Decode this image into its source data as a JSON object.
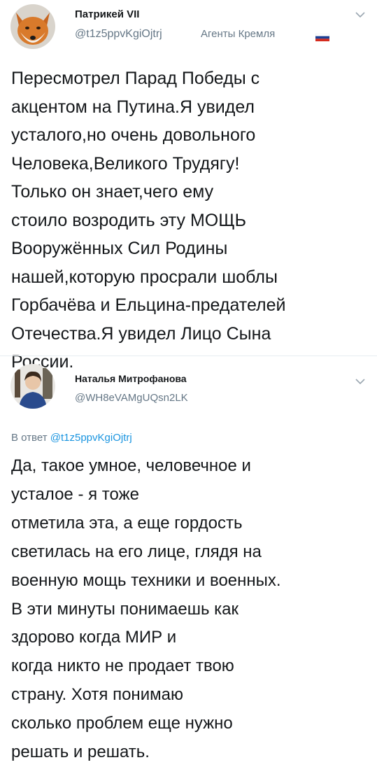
{
  "tweet1": {
    "name": "Патрикей VII",
    "handle": "@t1z5ppvKgiOjtrj",
    "list_name": "Агенты Кремля",
    "body_lines": [
      "Пересмотрел Парад Победы с",
      "акцентом на Путина.Я увидел",
      "усталого,но очень довольного",
      "Человека,Великого Трудягу!",
      "Только он знает,чего ему",
      "стоило возродить эту МОЩЬ",
      "Вооружённых Сил Родины",
      "нашей,которую просрали шоблы",
      "Горбачёва и Ельцина-предателей",
      "Отечества.Я увидел Лицо Сына",
      "России."
    ]
  },
  "tweet2": {
    "name": "Наталья Митрофанова",
    "handle": "@WH8eVAMgUQsn2LK",
    "reply_prefix": "В ответ",
    "reply_handle": "@t1z5ppvKgiOjtrj",
    "body_lines": [
      "Да, такое умное, человечное и",
      "усталое - я тоже",
      "отметила эта, а еще гордость",
      "светилась на его лице, глядя на",
      "военную мощь техники и военных.",
      "В эти минуты понимаешь как",
      "здорово когда МИР и",
      "когда никто не продает твою",
      "страну. Хотя понимаю",
      "сколько проблем еще нужно",
      "решать и решать."
    ]
  },
  "icons": {
    "avatar1": "fox-avatar",
    "avatar2": "woman-avatar",
    "menu": "chevron-down-icon",
    "flag": "russian-flag-icon"
  },
  "colors": {
    "text": "#14171a",
    "secondary": "#657786",
    "link": "#1b95e0",
    "flag_white": "#ffffff",
    "flag_blue": "#1c3f94",
    "flag_red": "#d52b1e"
  }
}
